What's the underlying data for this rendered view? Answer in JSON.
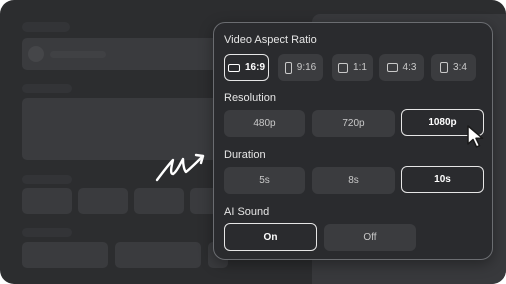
{
  "settings": {
    "aspect_ratio": {
      "label": "Video Aspect Ratio",
      "options": [
        "16:9",
        "9:16",
        "1:1",
        "4:3",
        "3:4"
      ],
      "selected": "16:9"
    },
    "resolution": {
      "label": "Resolution",
      "options": [
        "480p",
        "720p",
        "1080p"
      ],
      "selected": "1080p"
    },
    "duration": {
      "label": "Duration",
      "options": [
        "5s",
        "8s",
        "10s"
      ],
      "selected": "10s"
    },
    "ai_sound": {
      "label": "AI Sound",
      "options": [
        "On",
        "Off"
      ],
      "selected": "On"
    }
  },
  "icons": [
    "landscape-icon",
    "portrait-icon",
    "square-icon",
    "classic-landscape-icon",
    "classic-portrait-icon",
    "mouse-pointer-icon",
    "hand-drawn-arrow-icon"
  ],
  "colors": {
    "panel_bg": "#2a2b2e",
    "app_bg": "#2c2d2f",
    "option_bg": "#3b3c3f",
    "selected_border": "#e6e6e6"
  }
}
